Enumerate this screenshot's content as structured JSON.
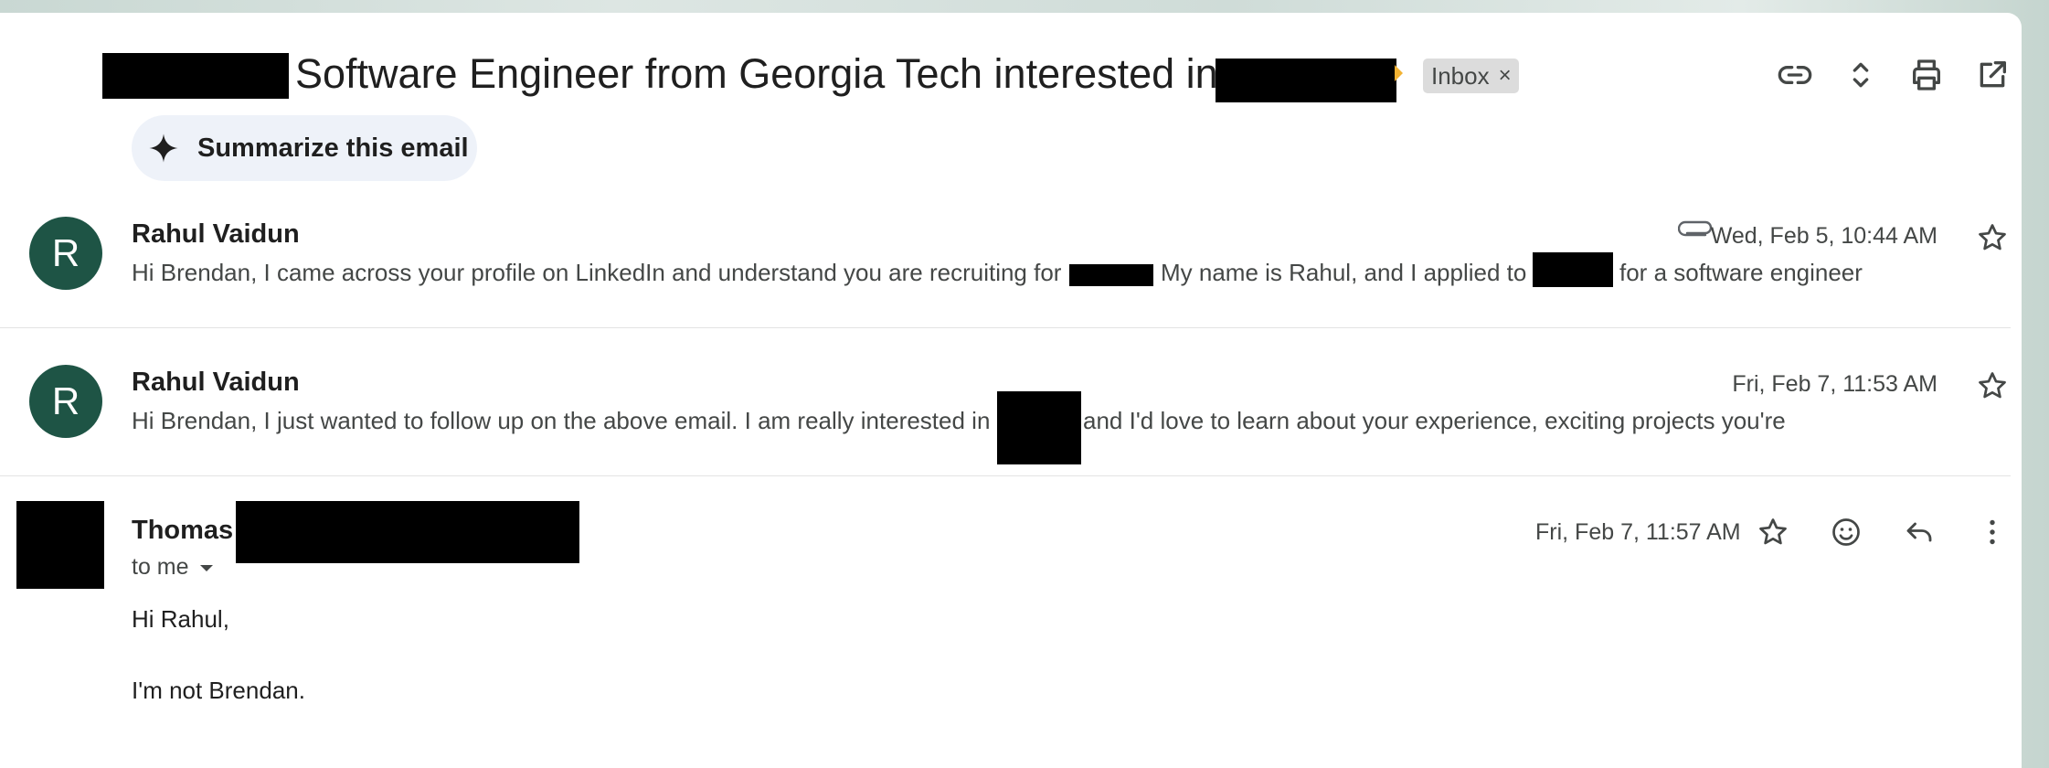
{
  "subject": {
    "text": "Software Engineer from Georgia Tech interested in",
    "label": "Inbox",
    "label_close": "×"
  },
  "toolbar": {
    "icons": [
      "link-icon",
      "expand-collapse-icon",
      "print-icon",
      "open-in-new-window-icon"
    ]
  },
  "summarize": {
    "label": "Summarize this email",
    "icon": "sparkle-icon"
  },
  "messages": [
    {
      "avatar": "R",
      "sender": "Rahul Vaidun",
      "date": "Wed, Feb 5, 10:44 AM",
      "has_attachment": true,
      "snippet_a": "Hi Brendan, I came across your profile on LinkedIn and understand you are recruiting for",
      "snippet_b": "My name is Rahul, and I applied to",
      "snippet_c": "for a software engineer"
    },
    {
      "avatar": "R",
      "sender": "Rahul Vaidun",
      "date": "Fri, Feb 7, 11:53 AM",
      "snippet_a": "Hi Brendan, I just wanted to follow up on the above email. I am really interested in",
      "snippet_b": "and I'd love to learn about your experience, exciting projects you're"
    },
    {
      "sender": "Thomas",
      "date": "Fri, Feb 7, 11:57 AM",
      "recipient": "to me",
      "body": [
        "Hi Rahul,",
        "I'm not Brendan."
      ]
    }
  ],
  "colors": {
    "avatar_bg": "#1e5445",
    "label_bg": "#dcdcdc",
    "summarize_bg": "#eef2f9",
    "label_marker": "#f2b233"
  }
}
